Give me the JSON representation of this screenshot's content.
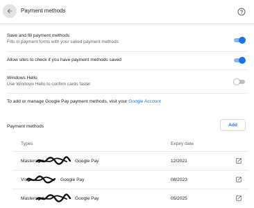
{
  "header": {
    "title": "Payment methods",
    "back_icon": "arrow-back-icon",
    "help_icon": "help-circle-icon"
  },
  "settings": [
    {
      "title": "Save and fill payment methods",
      "description": "Fills in payment forms with your saved payment methods",
      "enabled": true
    },
    {
      "title": "Allow sites to check if you have payment methods saved",
      "description": "",
      "enabled": true
    },
    {
      "title": "Windows Hello",
      "description": "Use Windows Hello to confirm cards faster",
      "enabled": false
    }
  ],
  "gpay": {
    "text": "To add or manage Google Pay payment methods, visit your",
    "link": "Google Account"
  },
  "payment_methods": {
    "label": "Payment methods",
    "add_label": "Add",
    "columns": [
      "Types",
      "Expiry date"
    ],
    "rows": [
      {
        "type": "Mastercard",
        "wallet": "Google Pay",
        "expiry": "12/2021"
      },
      {
        "type": "Visa",
        "wallet": "Google Pay",
        "expiry": "08/2023"
      },
      {
        "type": "Mastercard",
        "wallet": "Google Pay",
        "expiry": "05/2025"
      }
    ]
  },
  "colors": {
    "accent": "#1a73e8",
    "toggle_on_track": "#8ab4f8",
    "text_primary": "#202124",
    "text_secondary": "#5f6368"
  }
}
